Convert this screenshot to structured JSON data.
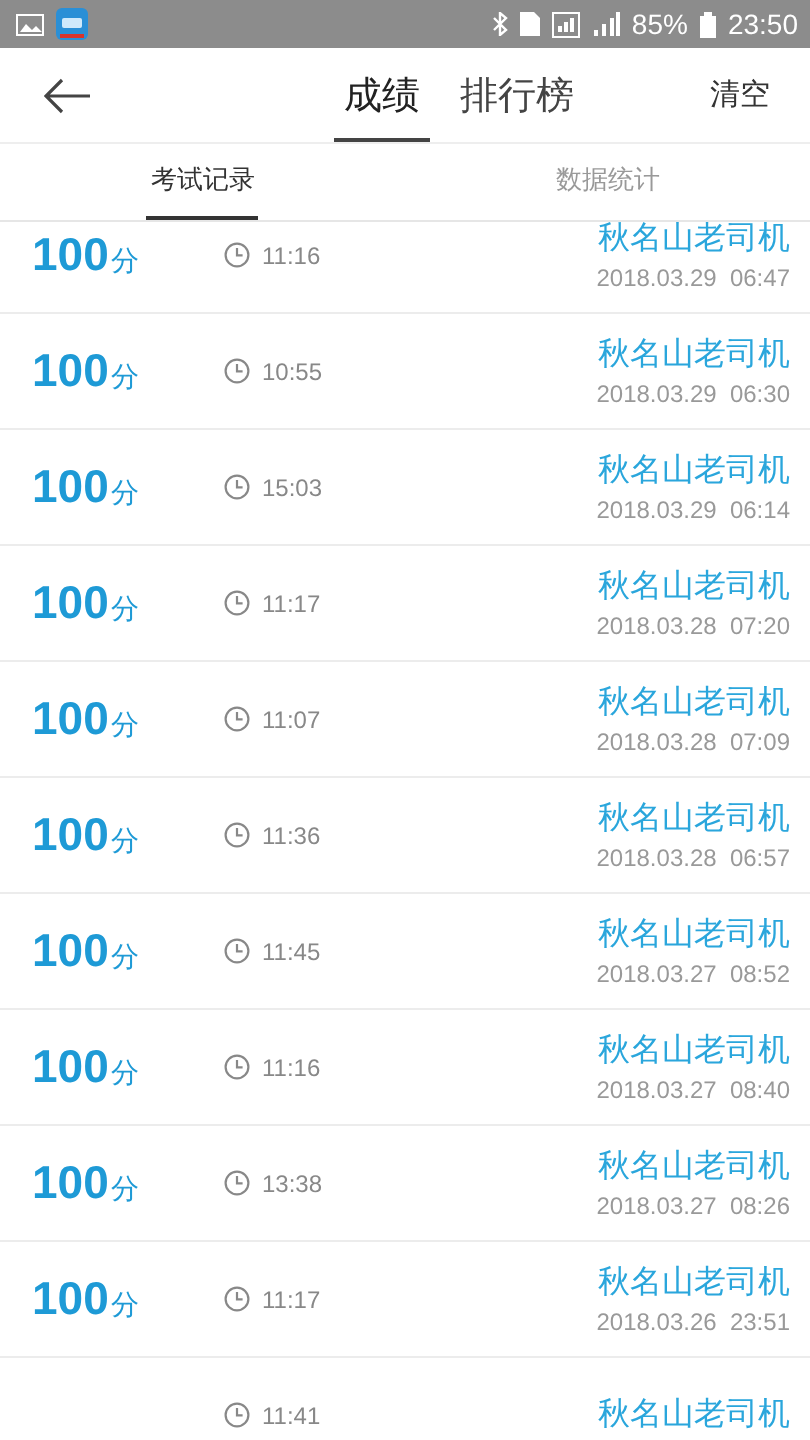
{
  "status_bar": {
    "battery": "85%",
    "time": "23:50"
  },
  "header": {
    "tabs": [
      {
        "label": "成绩",
        "selected": true
      },
      {
        "label": "排行榜",
        "selected": false
      }
    ],
    "action": "清空"
  },
  "sub_tabs": [
    {
      "label": "考试记录",
      "selected": true
    },
    {
      "label": "数据统计",
      "selected": false
    }
  ],
  "records": [
    {
      "score": "100",
      "unit": "分",
      "duration": "11:16",
      "name": "秋名山老司机",
      "date": "2018.03.29  06:47"
    },
    {
      "score": "100",
      "unit": "分",
      "duration": "10:55",
      "name": "秋名山老司机",
      "date": "2018.03.29  06:30"
    },
    {
      "score": "100",
      "unit": "分",
      "duration": "15:03",
      "name": "秋名山老司机",
      "date": "2018.03.29  06:14"
    },
    {
      "score": "100",
      "unit": "分",
      "duration": "11:17",
      "name": "秋名山老司机",
      "date": "2018.03.28  07:20"
    },
    {
      "score": "100",
      "unit": "分",
      "duration": "11:07",
      "name": "秋名山老司机",
      "date": "2018.03.28  07:09"
    },
    {
      "score": "100",
      "unit": "分",
      "duration": "11:36",
      "name": "秋名山老司机",
      "date": "2018.03.28  06:57"
    },
    {
      "score": "100",
      "unit": "分",
      "duration": "11:45",
      "name": "秋名山老司机",
      "date": "2018.03.27  08:52"
    },
    {
      "score": "100",
      "unit": "分",
      "duration": "11:16",
      "name": "秋名山老司机",
      "date": "2018.03.27  08:40"
    },
    {
      "score": "100",
      "unit": "分",
      "duration": "13:38",
      "name": "秋名山老司机",
      "date": "2018.03.27  08:26"
    },
    {
      "score": "100",
      "unit": "分",
      "duration": "11:17",
      "name": "秋名山老司机",
      "date": "2018.03.26  23:51"
    },
    {
      "duration": "11:41",
      "name": "秋名山老司机"
    }
  ]
}
